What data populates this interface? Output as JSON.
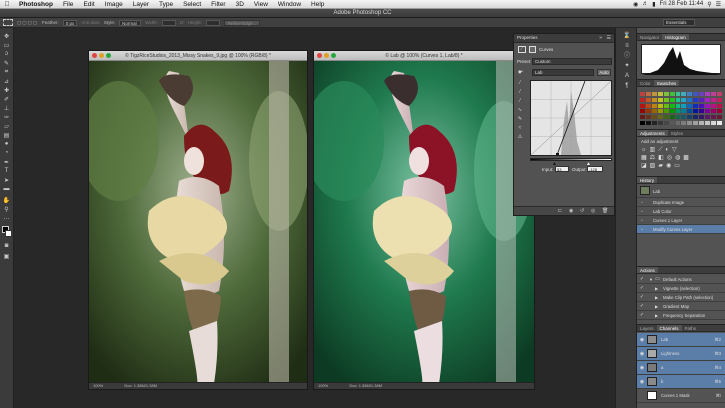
{
  "menubar": {
    "apple": "",
    "app": "Photoshop",
    "items": [
      "File",
      "Edit",
      "Image",
      "Layer",
      "Type",
      "Select",
      "Filter",
      "3D",
      "View",
      "Window",
      "Help"
    ],
    "clock": "Fri 28 Feb  11:44"
  },
  "window_title": "Adobe Photoshop CC",
  "options": {
    "feather_label": "Feather:",
    "feather_value": "0 px",
    "antialias": "Anti-alias",
    "style_label": "Style:",
    "style_value": "Normal",
    "width_label": "Width:",
    "height_label": "Height:",
    "refine": "Refine Edge...",
    "workspace": "Essentials"
  },
  "doc1": {
    "title": "© TigzRiceStudios_2013_Missy Snakes_9.jpg @ 100% (RGB/8) *",
    "zoom": "100%",
    "size": "Doc: 1.38M/1.38M"
  },
  "doc2": {
    "title": "© Lab @ 100% (Curves 1, Lab/8) *",
    "zoom": "100%",
    "size": "Doc: 1.38M/1.38M"
  },
  "properties": {
    "tab": "Properties",
    "title": "Curves",
    "preset_label": "Preset:",
    "preset_value": "Custom",
    "channel_value": "Lab",
    "auto": "Auto",
    "input_label": "Input:",
    "input_value": "53",
    "output_label": "Output:",
    "output_value": "-128"
  },
  "right": {
    "navigator_tabs": [
      "Navigator",
      "Histogram"
    ],
    "color_tabs": [
      "Color",
      "Swatches"
    ],
    "adjust_tabs": [
      "Adjustments",
      "Styles"
    ],
    "add_adjustment": "Add an adjustment",
    "history_tab": "History",
    "history_items": [
      "Lab",
      "Duplicate Image",
      "Lab Color",
      "Curves 1 Layer",
      "Modify Curves Layer"
    ],
    "actions_tab": "Actions",
    "actions_items": [
      "Default Actions",
      "Vignette (selection)",
      "Make Clip Path (selection)",
      "Gradient Map",
      "Frequency Separation"
    ],
    "layers_tabs": [
      "Layers",
      "Channels",
      "Paths"
    ],
    "channels": [
      {
        "name": "Lab",
        "key": "⌘2"
      },
      {
        "name": "Lightness",
        "key": "⌘3"
      },
      {
        "name": "a",
        "key": "⌘4"
      },
      {
        "name": "b",
        "key": "⌘5"
      },
      {
        "name": "Curves 1 Mask",
        "key": "⌘\\"
      }
    ]
  },
  "colors": {
    "accent": "#5b7ea9",
    "panel": "#535353",
    "canvas": "#282828"
  }
}
